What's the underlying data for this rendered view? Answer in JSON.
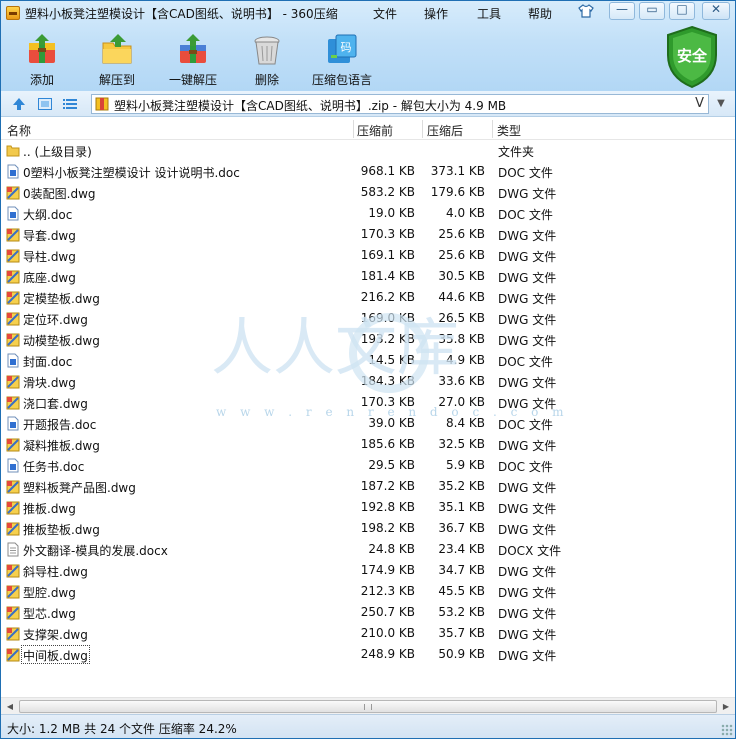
{
  "window": {
    "title": "塑料小板凳注塑模设计【含CAD图纸、说明书】 - 360压缩",
    "menu": [
      "文件",
      "操作",
      "工具",
      "帮助"
    ],
    "controls": {
      "minimize": "—",
      "maximize": "□",
      "close": "✕"
    }
  },
  "toolbar": {
    "buttons": [
      {
        "label": "添加",
        "icon": "add-archive-icon"
      },
      {
        "label": "解压到",
        "icon": "extract-to-icon"
      },
      {
        "label": "一键解压",
        "icon": "one-click-extract-icon"
      },
      {
        "label": "删除",
        "icon": "delete-trash-icon"
      },
      {
        "label": "压缩包语言",
        "icon": "archive-language-icon"
      }
    ],
    "shield_label": "安全",
    "language_glyph": "码"
  },
  "address": {
    "text": "塑料小板凳注塑模设计【含CAD图纸、说明书】.zip - 解包大小为 4.9 MB",
    "v_label": "V",
    "dropdown": "▼"
  },
  "columns": {
    "name": "名称",
    "size": "压缩前",
    "csize": "压缩后",
    "type": "类型"
  },
  "files": [
    {
      "name": ".. (上级目录)",
      "size": "",
      "csize": "",
      "type": "文件夹",
      "kind": "folder"
    },
    {
      "name": "0塑料小板凳注塑模设计 设计说明书.doc",
      "size": "968.1 KB",
      "csize": "373.1 KB",
      "type": "DOC 文件",
      "kind": "doc"
    },
    {
      "name": "0装配图.dwg",
      "size": "583.2 KB",
      "csize": "179.6 KB",
      "type": "DWG 文件",
      "kind": "dwg"
    },
    {
      "name": "大纲.doc",
      "size": "19.0 KB",
      "csize": "4.0 KB",
      "type": "DOC 文件",
      "kind": "doc"
    },
    {
      "name": "导套.dwg",
      "size": "170.3 KB",
      "csize": "25.6 KB",
      "type": "DWG 文件",
      "kind": "dwg"
    },
    {
      "name": "导柱.dwg",
      "size": "169.1 KB",
      "csize": "25.6 KB",
      "type": "DWG 文件",
      "kind": "dwg"
    },
    {
      "name": "底座.dwg",
      "size": "181.4 KB",
      "csize": "30.5 KB",
      "type": "DWG 文件",
      "kind": "dwg"
    },
    {
      "name": "定模垫板.dwg",
      "size": "216.2 KB",
      "csize": "44.6 KB",
      "type": "DWG 文件",
      "kind": "dwg"
    },
    {
      "name": "定位环.dwg",
      "size": "169.0 KB",
      "csize": "26.5 KB",
      "type": "DWG 文件",
      "kind": "dwg"
    },
    {
      "name": "动模垫板.dwg",
      "size": "193.2 KB",
      "csize": "35.8 KB",
      "type": "DWG 文件",
      "kind": "dwg"
    },
    {
      "name": "封面.doc",
      "size": "14.5 KB",
      "csize": "4.9 KB",
      "type": "DOC 文件",
      "kind": "doc"
    },
    {
      "name": "滑块.dwg",
      "size": "184.3 KB",
      "csize": "33.6 KB",
      "type": "DWG 文件",
      "kind": "dwg"
    },
    {
      "name": "浇口套.dwg",
      "size": "170.3 KB",
      "csize": "27.0 KB",
      "type": "DWG 文件",
      "kind": "dwg"
    },
    {
      "name": "开题报告.doc",
      "size": "39.0 KB",
      "csize": "8.4 KB",
      "type": "DOC 文件",
      "kind": "doc"
    },
    {
      "name": "凝料推板.dwg",
      "size": "185.6 KB",
      "csize": "32.5 KB",
      "type": "DWG 文件",
      "kind": "dwg"
    },
    {
      "name": "任务书.doc",
      "size": "29.5 KB",
      "csize": "5.9 KB",
      "type": "DOC 文件",
      "kind": "doc"
    },
    {
      "name": "塑料板凳产品图.dwg",
      "size": "187.2 KB",
      "csize": "35.2 KB",
      "type": "DWG 文件",
      "kind": "dwg"
    },
    {
      "name": "推板.dwg",
      "size": "192.8 KB",
      "csize": "35.1 KB",
      "type": "DWG 文件",
      "kind": "dwg"
    },
    {
      "name": "推板垫板.dwg",
      "size": "198.2 KB",
      "csize": "36.7 KB",
      "type": "DWG 文件",
      "kind": "dwg"
    },
    {
      "name": "外文翻译-模具的发展.docx",
      "size": "24.8 KB",
      "csize": "23.4 KB",
      "type": "DOCX 文件",
      "kind": "docx"
    },
    {
      "name": "斜导柱.dwg",
      "size": "174.9 KB",
      "csize": "34.7 KB",
      "type": "DWG 文件",
      "kind": "dwg"
    },
    {
      "name": "型腔.dwg",
      "size": "212.3 KB",
      "csize": "45.5 KB",
      "type": "DWG 文件",
      "kind": "dwg"
    },
    {
      "name": "型芯.dwg",
      "size": "250.7 KB",
      "csize": "53.2 KB",
      "type": "DWG 文件",
      "kind": "dwg"
    },
    {
      "name": "支撑架.dwg",
      "size": "210.0 KB",
      "csize": "35.7 KB",
      "type": "DWG 文件",
      "kind": "dwg"
    },
    {
      "name": "中间板.dwg",
      "size": "248.9 KB",
      "csize": "50.9 KB",
      "type": "DWG 文件",
      "kind": "dwg",
      "selected": true
    }
  ],
  "watermark": {
    "text": "人人文库",
    "url": "w w w . r e n r e n d o c . c o m"
  },
  "status": {
    "text": "大小: 1.2 MB 共 24 个文件 压缩率 24.2%"
  },
  "colors": {
    "accent": "#1f6fb3",
    "shield": "#3aa32f",
    "dwg_icon": "#f2c230",
    "doc_icon": "#2f6fd1"
  }
}
